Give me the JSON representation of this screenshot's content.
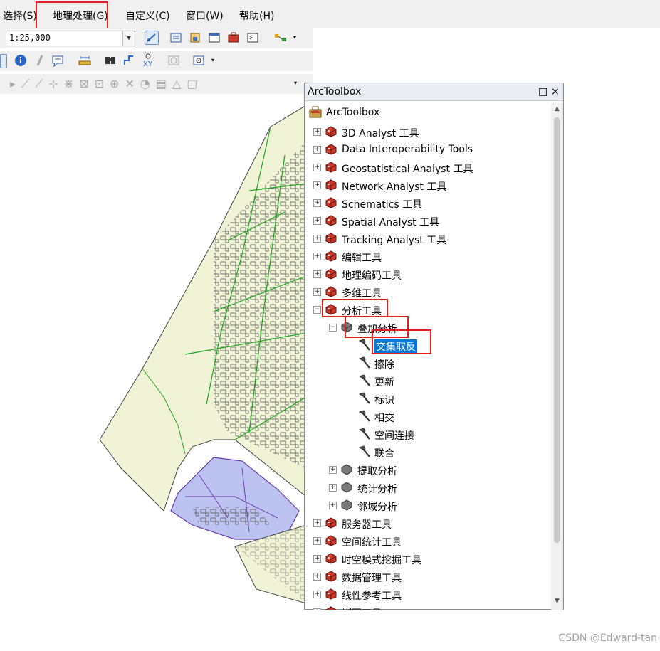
{
  "menu": {
    "items": [
      "选择(S)",
      "地理处理(G)",
      "自定义(C)",
      "窗口(W)",
      "帮助(H)"
    ]
  },
  "scale": {
    "value": "1:25,000"
  },
  "panel": {
    "title": "ArcToolbox",
    "maximize": "□",
    "close": "×",
    "root": "ArcToolbox",
    "items": [
      {
        "label": "3D Analyst 工具",
        "state": "collapsed"
      },
      {
        "label": "Data Interoperability Tools",
        "state": "collapsed"
      },
      {
        "label": "Geostatistical Analyst 工具",
        "state": "collapsed"
      },
      {
        "label": "Network Analyst 工具",
        "state": "collapsed"
      },
      {
        "label": "Schematics 工具",
        "state": "collapsed"
      },
      {
        "label": "Spatial Analyst 工具",
        "state": "collapsed"
      },
      {
        "label": "Tracking Analyst 工具",
        "state": "collapsed"
      },
      {
        "label": "编辑工具",
        "state": "collapsed"
      },
      {
        "label": "地理编码工具",
        "state": "collapsed"
      },
      {
        "label": "多维工具",
        "state": "collapsed"
      },
      {
        "label": "分析工具",
        "state": "expanded"
      }
    ],
    "subtoolsets": {
      "overlay": {
        "label": "叠加分析",
        "state": "expanded"
      },
      "extract": {
        "label": "提取分析",
        "state": "collapsed"
      },
      "stats": {
        "label": "统计分析",
        "state": "collapsed"
      },
      "proximity": {
        "label": "邻域分析",
        "state": "collapsed"
      }
    },
    "tools": [
      "交集取反",
      "擦除",
      "更新",
      "标识",
      "相交",
      "空间连接",
      "联合"
    ],
    "selected_tool": "交集取反",
    "after_items": [
      {
        "label": "服务器工具",
        "state": "collapsed"
      },
      {
        "label": "空间统计工具",
        "state": "collapsed"
      },
      {
        "label": "时空模式挖掘工具",
        "state": "collapsed"
      },
      {
        "label": "数据管理工具",
        "state": "collapsed"
      },
      {
        "label": "线性参考工具",
        "state": "collapsed"
      },
      {
        "label": "制图工具",
        "state": "collapsed"
      }
    ]
  },
  "watermark": "CSDN @Edward-tan",
  "colors": {
    "selection": "#0a78d7",
    "highlight_box": "#e02020",
    "map_fill": "#f1f3d6",
    "map_selected": "#bcc3f0"
  }
}
